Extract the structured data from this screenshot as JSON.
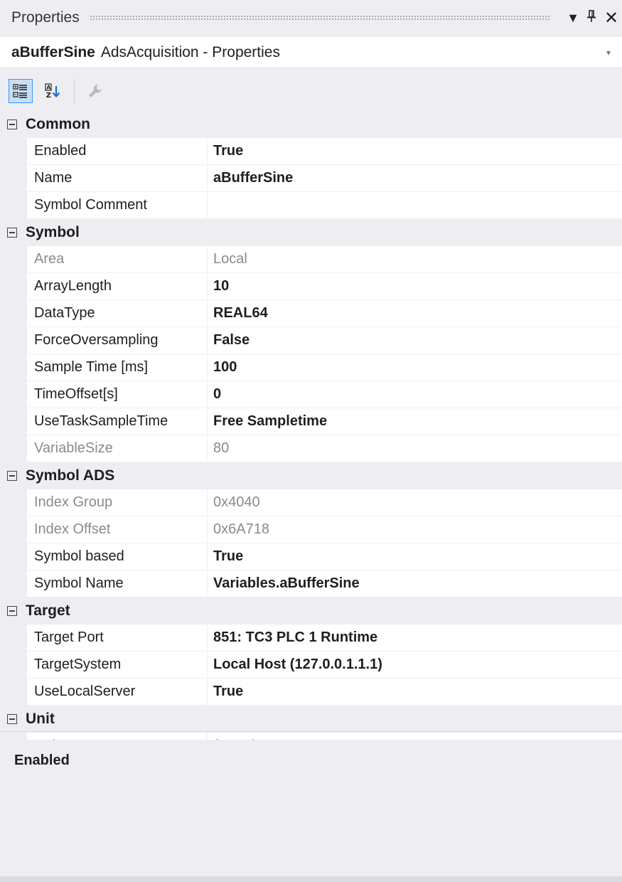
{
  "window": {
    "title": "Properties",
    "controls": {
      "dropdown": "▼",
      "pin": "ꟼ",
      "close": "✕"
    }
  },
  "object_selector": {
    "name": "aBufferSine",
    "type": "AdsAcquisition - Properties",
    "dropdown": "▾"
  },
  "toolbar": {
    "buttons": [
      {
        "icon": "categorized-icon",
        "active": true
      },
      {
        "icon": "alphabetical-sort-icon",
        "active": false
      },
      {
        "icon": "property-pages-wrench-icon",
        "active": false
      }
    ]
  },
  "categories": [
    {
      "label": "Common",
      "rows": [
        {
          "name": "Enabled",
          "value": "True",
          "readonly": false
        },
        {
          "name": "Name",
          "value": "aBufferSine",
          "readonly": false
        },
        {
          "name": "Symbol Comment",
          "value": "",
          "readonly": false
        }
      ]
    },
    {
      "label": "Symbol",
      "rows": [
        {
          "name": "Area",
          "value": "Local",
          "readonly": true
        },
        {
          "name": "ArrayLength",
          "value": "10",
          "readonly": false
        },
        {
          "name": "DataType",
          "value": "REAL64",
          "readonly": false
        },
        {
          "name": "ForceOversampling",
          "value": "False",
          "readonly": false
        },
        {
          "name": "Sample Time [ms]",
          "value": "100",
          "readonly": false
        },
        {
          "name": "TimeOffset[s]",
          "value": "0",
          "readonly": false
        },
        {
          "name": "UseTaskSampleTime",
          "value": "Free Sampletime",
          "readonly": false
        },
        {
          "name": "VariableSize",
          "value": "80",
          "readonly": true
        }
      ]
    },
    {
      "label": "Symbol ADS",
      "rows": [
        {
          "name": "Index Group",
          "value": "0x4040",
          "readonly": true
        },
        {
          "name": "Index Offset",
          "value": "0x6A718",
          "readonly": true
        },
        {
          "name": "Symbol based",
          "value": "True",
          "readonly": false
        },
        {
          "name": "Symbol Name",
          "value": "Variables.aBufferSine",
          "readonly": false
        }
      ]
    },
    {
      "label": "Target",
      "rows": [
        {
          "name": "Target Port",
          "value": "851: TC3 PLC 1 Runtime",
          "readonly": false
        },
        {
          "name": "TargetSystem",
          "value": "Local Host (127.0.0.1.1.1)",
          "readonly": false
        },
        {
          "name": "UseLocalServer",
          "value": "True",
          "readonly": false
        }
      ]
    },
    {
      "label": "Unit",
      "rows": [
        {
          "name": "Unit",
          "value": "(None)",
          "readonly": true
        }
      ]
    }
  ],
  "description": {
    "title": "Enabled"
  }
}
